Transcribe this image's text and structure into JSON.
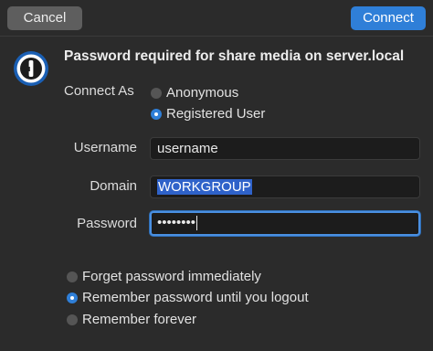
{
  "buttons": {
    "cancel": "Cancel",
    "connect": "Connect"
  },
  "dialog": {
    "title": "Password required for share media on server.local"
  },
  "connect_as": {
    "label": "Connect As",
    "options": [
      "Anonymous",
      "Registered User"
    ],
    "selected": "Registered User"
  },
  "fields": {
    "username": {
      "label": "Username",
      "value": "username"
    },
    "domain": {
      "label": "Domain",
      "value": "WORKGROUP"
    },
    "password": {
      "label": "Password",
      "value": "••••••••"
    }
  },
  "remember": {
    "options": [
      "Forget password immediately",
      "Remember password until you logout",
      "Remember forever"
    ],
    "selected": "Remember password until you logout"
  },
  "colors": {
    "accent": "#2f7fd8",
    "background": "#2b2b2b",
    "field_bg": "#1c1c1c"
  },
  "icons": {
    "logo": "1password-keyhole-icon"
  }
}
